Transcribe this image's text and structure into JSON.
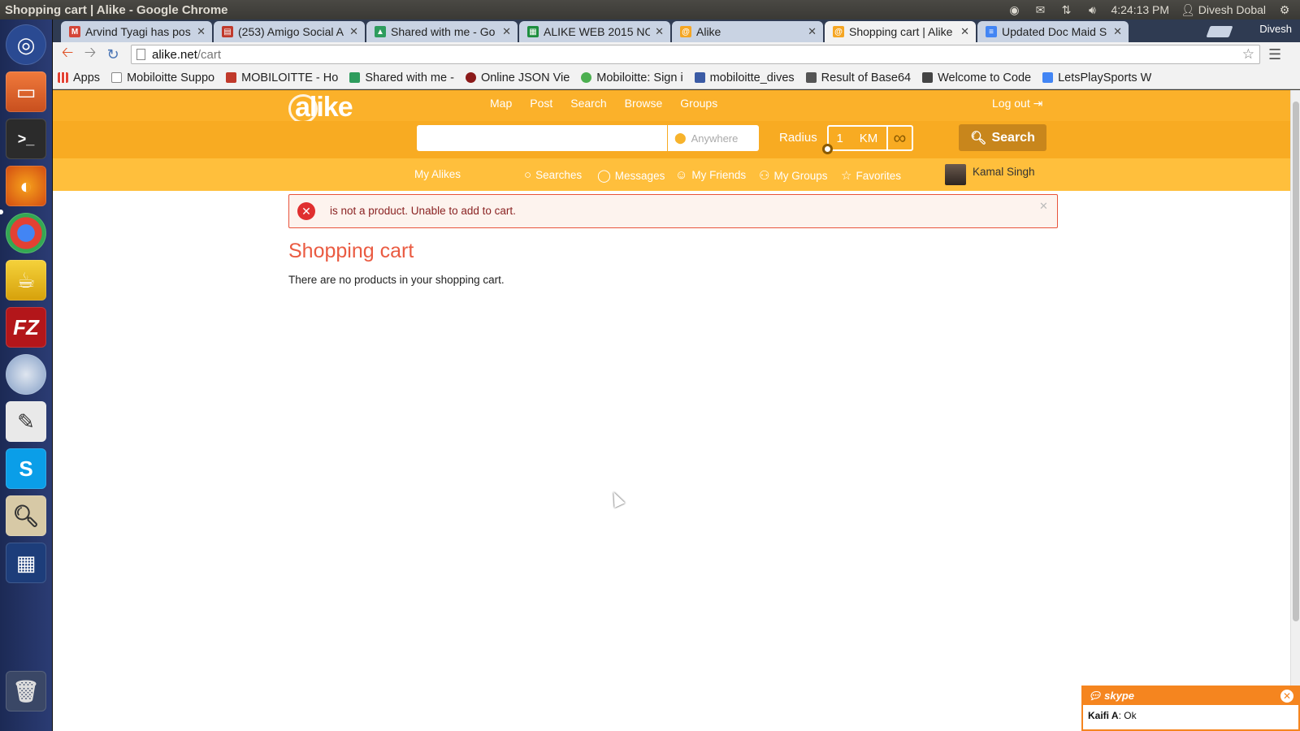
{
  "os": {
    "window_title": "Shopping cart | Alike - Google Chrome",
    "clock": "4:24:13 PM",
    "user": "Divesh Dobal"
  },
  "chrome": {
    "profile": "Divesh",
    "tabs": [
      {
        "label": "Arvind Tyagi has pos",
        "icon": "gmail-icon",
        "color": "#d44638"
      },
      {
        "label": "(253) Amigo Social A",
        "icon": "calendar-icon",
        "color": "#c0392b"
      },
      {
        "label": "Shared with me - Go",
        "icon": "drive-icon",
        "color": "#2e9c5d"
      },
      {
        "label": "ALIKE WEB 2015 NO",
        "icon": "sheets-icon",
        "color": "#1e8e3e"
      },
      {
        "label": "Alike",
        "icon": "alike-icon",
        "color": "#f5a623"
      },
      {
        "label": "Shopping cart | Alike",
        "icon": "alike-icon",
        "color": "#f5a623"
      },
      {
        "label": "Updated Doc Maid S",
        "icon": "docs-icon",
        "color": "#4285f4"
      }
    ],
    "url_host": "alike.net",
    "url_path": "/cart",
    "bookmarks": [
      {
        "label": "Apps",
        "icon": "apps-icon",
        "color": "#e34133"
      },
      {
        "label": "Mobiloitte Suppo",
        "icon": "page-icon",
        "color": "#ffffff"
      },
      {
        "label": "MOBILOITTE - Ho",
        "icon": "calendar-icon",
        "color": "#c0392b"
      },
      {
        "label": "Shared with me -",
        "icon": "drive-icon",
        "color": "#2e9c5d"
      },
      {
        "label": "Online JSON Vie",
        "icon": "json-icon",
        "color": "#8b1a1a"
      },
      {
        "label": "Mobiloitte: Sign i",
        "icon": "cloud-icon",
        "color": "#4caf50"
      },
      {
        "label": "mobiloitte_dives",
        "icon": "cup-icon",
        "color": "#3b5ba5"
      },
      {
        "label": "Result of Base64",
        "icon": "tool-icon",
        "color": "#555555"
      },
      {
        "label": "Welcome to Code",
        "icon": "code-icon",
        "color": "#444444"
      },
      {
        "label": "LetsPlaySports W",
        "icon": "docs-icon",
        "color": "#4285f4"
      }
    ]
  },
  "site": {
    "brand_color": "#fbb12a",
    "logo": "alike",
    "top_nav": [
      "Map",
      "Post",
      "Search",
      "Browse",
      "Groups"
    ],
    "logout": "Log out",
    "search_placeholder": "",
    "location_placeholder": "Anywhere",
    "radius_label": "Radius",
    "radius_value": "1",
    "radius_unit": "KM",
    "search_button": "Search",
    "sub_nav": {
      "my_alikes": "My Alikes",
      "searches": "Searches",
      "messages": "Messages",
      "my_friends": "My Friends",
      "my_groups": "My Groups",
      "favorites": "Favorites"
    },
    "user_name": "Kamal Singh"
  },
  "alert": {
    "message": "is not a product. Unable to add to cart.",
    "color": "#e8543c"
  },
  "cart": {
    "title": "Shopping cart",
    "empty_message": "There are no products in your shopping cart."
  },
  "skype": {
    "brand": "skype",
    "sender": "Kaifi A",
    "message": ": Ok"
  }
}
